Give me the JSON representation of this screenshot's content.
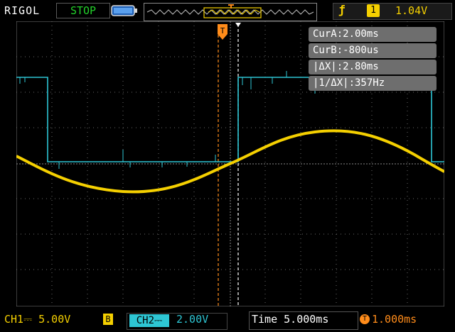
{
  "header": {
    "brand": "RIGOL",
    "run_state": "STOP",
    "trigger": {
      "edge_icon": "rising-edge-icon",
      "source": "1",
      "level": "1.04V"
    }
  },
  "cursors": {
    "cur_a": "CurA:2.00ms",
    "cur_b": "CurB:-800us",
    "delta_x": "|ΔX|:2.80ms",
    "inv_delta_x": "|1/ΔX|:357Hz"
  },
  "footer": {
    "ch1": {
      "label": "CH1",
      "scale": "5.00V",
      "bw_limit": "B"
    },
    "ch2": {
      "label": "CH2",
      "scale": "2.00V"
    },
    "timebase": "Time 5.000ms",
    "trigger_offset": "1.000ms"
  },
  "colors": {
    "ch1": "#f5d000",
    "ch2": "#2ec6d4",
    "trigger": "#ff8c1a",
    "grid": "#6a6a6a"
  },
  "markers": {
    "trigger_marker": "T",
    "ch2_ground_marker": "2"
  }
}
